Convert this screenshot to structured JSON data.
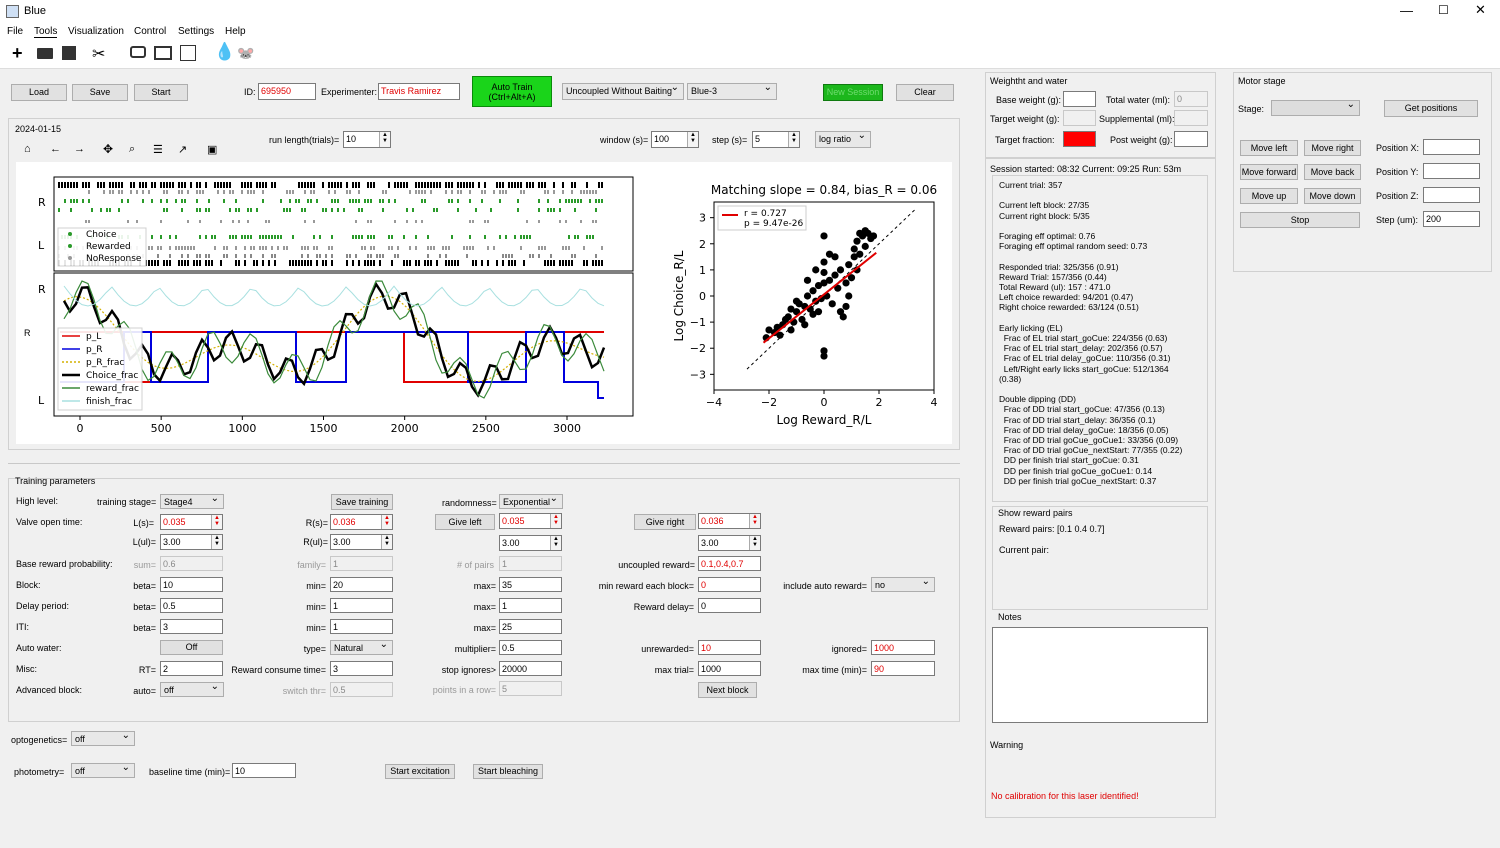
{
  "window": {
    "title": "Blue"
  },
  "menu": [
    "File",
    "Tools",
    "Visualization",
    "Control",
    "Settings",
    "Help"
  ],
  "top": {
    "load": "Load",
    "save": "Save",
    "start": "Start",
    "id_label": "ID:",
    "id_value": "695950",
    "experimenter_label": "Experimenter:",
    "experimenter_value": "Travis Ramirez",
    "auto_train": "Auto Train\n(Ctrl+Alt+A)",
    "task": "Uncoupled Without Baiting",
    "rig": "Blue-3",
    "new_session": "New Session",
    "clear": "Clear"
  },
  "plot_toolbar": {
    "date": "2024-01-15",
    "run_length_label": "run length(trials)=",
    "run_length": "10",
    "window_label": "window (s)=",
    "window": "100",
    "step_label": "step (s)=",
    "step": "5",
    "ratio": "log ratio"
  },
  "left_plot": {
    "ylabels": [
      "R",
      "L",
      "R",
      "L"
    ],
    "legend_top": [
      "Choice",
      "Rewarded",
      "NoResponse"
    ],
    "legend_bottom": [
      "p_L",
      "p_R",
      "p_R_frac",
      "Choice_frac",
      "reward_frac",
      "finish_frac"
    ],
    "x_ticks": [
      "0",
      "500",
      "1000",
      "1500",
      "2000",
      "2500",
      "3000"
    ]
  },
  "chart_data": {
    "type": "scatter",
    "title": "Matching slope = 0.84, bias_R = 0.06",
    "xlabel": "Log Reward_R/L",
    "ylabel": "Log Choice_R/L",
    "xlim": [
      -4,
      4
    ],
    "ylim": [
      -3.6,
      3.6
    ],
    "x_ticks": [
      "−4",
      "−2",
      "0",
      "2",
      "4"
    ],
    "y_ticks": [
      "3",
      "2",
      "1",
      "0",
      "−1",
      "−2",
      "−3"
    ],
    "legend": [
      "r = 0.727",
      "p = 9.47e-26"
    ],
    "fit_line": {
      "slope": 0.84,
      "intercept": 0.06
    },
    "points": [
      [
        -2.1,
        -1.6
      ],
      [
        -2.0,
        -1.3
      ],
      [
        -1.8,
        -1.4
      ],
      [
        -1.7,
        -1.2
      ],
      [
        -1.5,
        -1.1
      ],
      [
        -1.4,
        -0.9
      ],
      [
        -1.6,
        -1.5
      ],
      [
        -1.3,
        -0.8
      ],
      [
        -1.2,
        -0.5
      ],
      [
        -1.1,
        -1.0
      ],
      [
        -1.0,
        -0.6
      ],
      [
        -0.9,
        -0.3
      ],
      [
        -0.8,
        -0.9
      ],
      [
        -0.7,
        -0.4
      ],
      [
        -0.6,
        0.0
      ],
      [
        -0.5,
        -0.5
      ],
      [
        -0.4,
        0.2
      ],
      [
        -0.3,
        -0.2
      ],
      [
        -0.2,
        0.4
      ],
      [
        -0.1,
        -0.1
      ],
      [
        0.0,
        2.3
      ],
      [
        0.0,
        1.3
      ],
      [
        0.0,
        0.9
      ],
      [
        0.0,
        0.5
      ],
      [
        0.0,
        -2.3
      ],
      [
        0.0,
        -2.1
      ],
      [
        0.1,
        0.0
      ],
      [
        0.2,
        0.6
      ],
      [
        0.3,
        -0.3
      ],
      [
        0.4,
        0.8
      ],
      [
        0.5,
        0.3
      ],
      [
        0.6,
        1.0
      ],
      [
        0.7,
        -0.8
      ],
      [
        0.8,
        0.5
      ],
      [
        0.9,
        1.2
      ],
      [
        1.0,
        0.7
      ],
      [
        1.1,
        1.5
      ],
      [
        1.2,
        2.1
      ],
      [
        1.3,
        1.6
      ],
      [
        1.4,
        2.3
      ],
      [
        1.5,
        1.9
      ],
      [
        1.6,
        2.4
      ],
      [
        1.7,
        2.2
      ],
      [
        1.8,
        2.3
      ],
      [
        1.5,
        2.5
      ],
      [
        1.3,
        2.4
      ],
      [
        1.1,
        1.8
      ],
      [
        0.8,
        -0.4
      ],
      [
        0.6,
        -0.6
      ],
      [
        -0.4,
        -0.7
      ],
      [
        -0.6,
        0.6
      ],
      [
        -0.3,
        1.0
      ],
      [
        0.2,
        1.6
      ],
      [
        0.4,
        1.5
      ],
      [
        -1.0,
        -0.2
      ],
      [
        -1.2,
        -1.3
      ],
      [
        -0.7,
        -1.1
      ],
      [
        0.9,
        0.0
      ],
      [
        1.2,
        1.0
      ],
      [
        -0.2,
        -0.6
      ]
    ]
  },
  "training": {
    "title": "Training parameters",
    "high_level": "High level:",
    "training_stage_label": "training stage=",
    "training_stage": "Stage4",
    "save_training": "Save training",
    "randomness_label": "randomness=",
    "randomness": "Exponential",
    "valve_open_time": "Valve open time:",
    "L_s_label": "L(s)=",
    "L_s": "0.035",
    "R_s_label": "R(s)=",
    "R_s": "0.036",
    "give_left": "Give left",
    "give_left_val": "0.035",
    "give_right": "Give right",
    "give_right_val": "0.036",
    "L_ul_label": "L(ul)=",
    "L_ul": "3.00",
    "R_ul_label": "R(ul)=",
    "R_ul": "3.00",
    "give_left_ul": "3.00",
    "give_right_ul": "3.00",
    "base_reward": "Base reward probability:",
    "sum_label": "sum=",
    "sum": "0.6",
    "family_label": "family=",
    "family": "1",
    "pairs_label": "# of pairs",
    "pairs": "1",
    "uncoupled_label": "uncoupled reward=",
    "uncoupled": "0.1,0.4,0.7",
    "block": "Block:",
    "beta_label": "beta=",
    "block_beta": "10",
    "min_label": "min=",
    "block_min": "20",
    "max_label": "max=",
    "block_max": "35",
    "min_reward_label": "min reward each block=",
    "min_reward": "0",
    "auto_reward_label": "include auto reward=",
    "auto_reward": "no",
    "delay": "Delay period:",
    "delay_beta": "0.5",
    "delay_min": "1",
    "delay_max": "1",
    "reward_delay_label": "Reward delay=",
    "reward_delay": "0",
    "iti": "ITI:",
    "iti_beta": "3",
    "iti_min": "1",
    "iti_max": "25",
    "auto_water": "Auto water:",
    "auto_water_btn": "Off",
    "type_label": "type=",
    "type": "Natural",
    "multiplier_label": "multiplier=",
    "multiplier": "0.5",
    "unrewarded_label": "unrewarded=",
    "unrewarded": "10",
    "ignored_label": "ignored=",
    "ignored": "1000",
    "misc": "Misc:",
    "rt_label": "RT=",
    "rt": "2",
    "consume_label": "Reward consume time=",
    "consume": "3",
    "stop_ignores_label": "stop ignores>",
    "stop_ignores": "20000",
    "max_trial_label": "max trial=",
    "max_trial": "1000",
    "max_time_label": "max time (min)=",
    "max_time": "90",
    "advanced": "Advanced block:",
    "auto_label": "auto=",
    "auto": "off",
    "switch_label": "switch thr=",
    "switch": "0.5",
    "points_label": "points in a row=",
    "points": "5",
    "next_block": "Next block"
  },
  "bottom": {
    "opto_label": "optogenetics=",
    "opto": "off",
    "photo_label": "photometry=",
    "photo": "off",
    "baseline_label": "baseline time (min)=",
    "baseline": "10",
    "start_excitation": "Start excitation",
    "start_bleaching": "Start bleaching"
  },
  "weight": {
    "title": "Weightht and water",
    "base_weight": "Base weight (g):",
    "total_water": "Total water (ml):",
    "total_water_val": "0",
    "target_weight": "Target weight (g):",
    "supplemental": "Supplemental (ml):",
    "target_fraction": "Target fraction:",
    "post_weight": "Post weight (g):"
  },
  "motor": {
    "title": "Motor stage",
    "stage": "Stage:",
    "get_positions": "Get positions",
    "move_left": "Move left",
    "move_right": "Move right",
    "move_forward": "Move forward",
    "move_back": "Move back",
    "move_up": "Move up",
    "move_down": "Move down",
    "stop": "Stop",
    "pos_x": "Position X:",
    "pos_y": "Position Y:",
    "pos_z": "Position Z:",
    "step": "Step (um):",
    "step_val": "200"
  },
  "session": {
    "header": "Session started: 08:32  Current: 09:25  Run: 53m",
    "text": "Current trial: 357\n\nCurrent left block: 27/35\nCurrent right block: 5/35\n\nForaging eff optimal: 0.76\nForaging eff optimal random seed: 0.73\n\nResponded trial: 325/356 (0.91)\nReward Trial: 157/356 (0.44)\nTotal Reward (ul): 157 : 471.0\nLeft choice rewarded: 94/201 (0.47)\nRight choice rewarded: 63/124 (0.51)\n\nEarly licking (EL)\n  Frac of EL trial start_goCue: 224/356 (0.63)\n  Frac of EL trial start_delay: 202/356 (0.57)\n  Frac of EL trial delay_goCue: 110/356 (0.31)\n  Left/Right early licks start_goCue: 512/1364\n(0.38)\n\nDouble dipping (DD)\n  Frac of DD trial start_goCue: 47/356 (0.13)\n  Frac of DD trial start_delay: 36/356 (0.1)\n  Frac of DD trial delay_goCue: 18/356 (0.05)\n  Frac of DD trial goCue_goCue1: 33/356 (0.09)\n  Frac of DD trial goCue_nextStart: 77/355 (0.22)\n  DD per finish trial start_goCue: 0.31\n  DD per finish trial goCue_goCue1: 0.14\n  DD per finish trial goCue_nextStart: 0.37"
  },
  "reward_pairs": {
    "title": "Show reward pairs",
    "pairs": "Reward pairs: [0.1 0.4 0.7]",
    "current": "Current pair:"
  },
  "notes": {
    "title": "Notes"
  },
  "warning": {
    "title": "Warning",
    "message": "No calibration for this laser identified!"
  }
}
